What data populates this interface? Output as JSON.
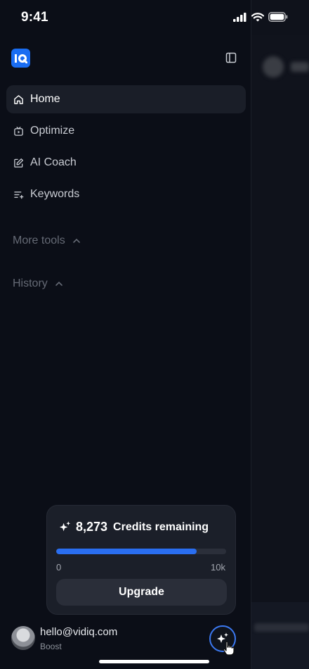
{
  "status_bar": {
    "time": "9:41"
  },
  "nav": {
    "items": [
      {
        "label": "Home",
        "icon": "home-icon",
        "active": true
      },
      {
        "label": "Optimize",
        "icon": "optimize-icon",
        "active": false
      },
      {
        "label": "AI Coach",
        "icon": "edit-icon",
        "active": false
      },
      {
        "label": "Keywords",
        "icon": "keywords-icon",
        "active": false
      }
    ]
  },
  "sections": {
    "more_tools": "More tools",
    "history": "History"
  },
  "credits": {
    "count": "8,273",
    "label": "Credits remaining",
    "progress_fraction": 0.827,
    "min_label": "0",
    "max_label": "10k",
    "upgrade_label": "Upgrade"
  },
  "user": {
    "email": "hello@vidiq.com",
    "plan": "Boost"
  },
  "colors": {
    "accent": "#2a6ef0",
    "background": "#0b0e17",
    "card": "#1b1f29"
  }
}
